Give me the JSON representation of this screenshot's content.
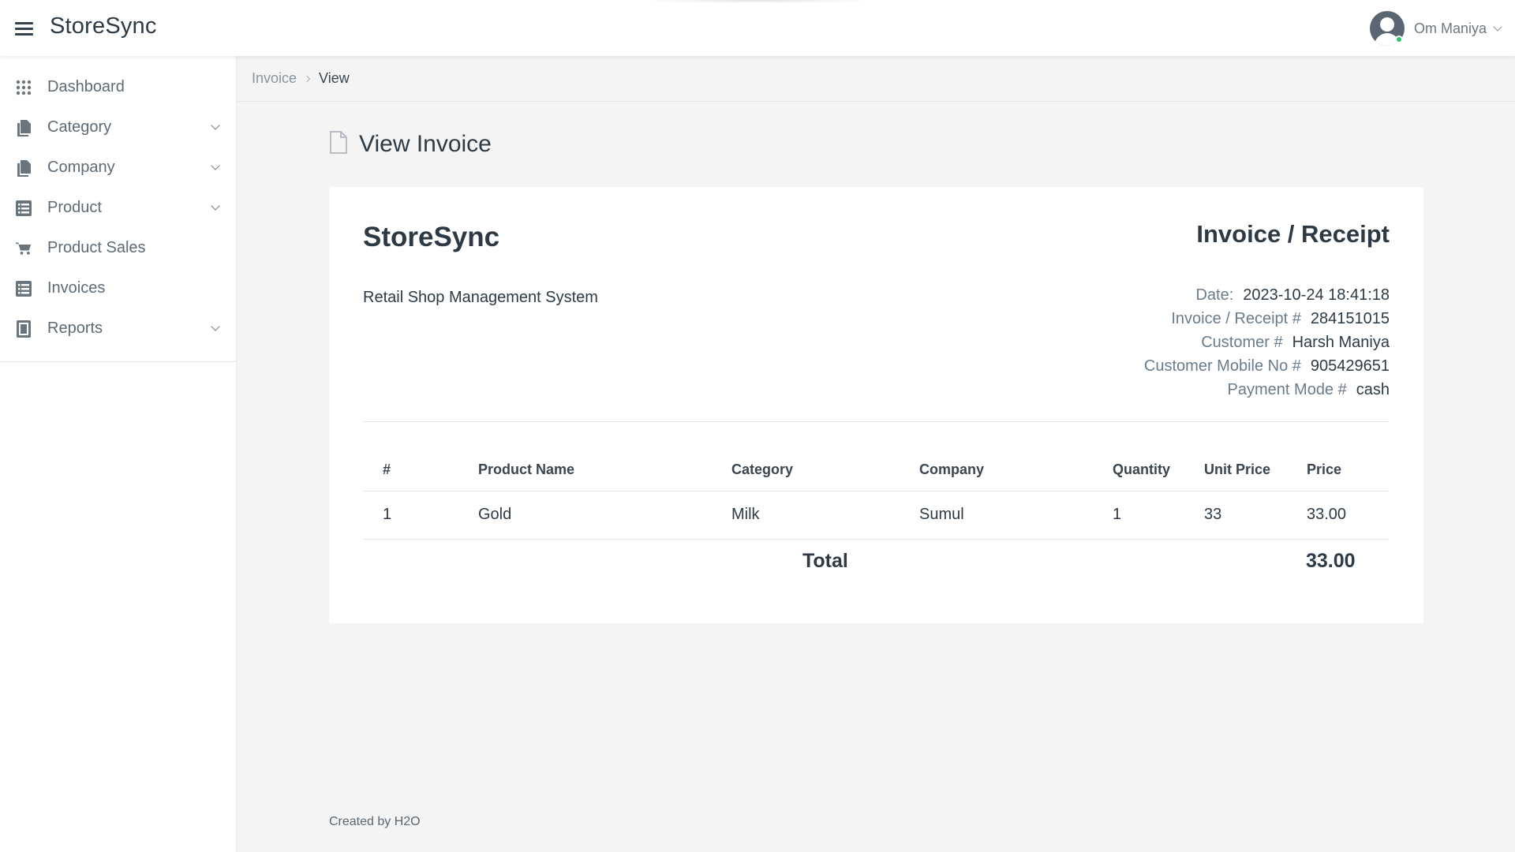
{
  "app": {
    "brand": "StoreSync"
  },
  "header": {
    "user_name": "Om Maniya"
  },
  "sidebar": {
    "items": [
      {
        "label": "Dashboard",
        "icon": "grid-icon",
        "has_children": false
      },
      {
        "label": "Category",
        "icon": "documents-icon",
        "has_children": true
      },
      {
        "label": "Company",
        "icon": "documents-icon",
        "has_children": true
      },
      {
        "label": "Product",
        "icon": "list-icon",
        "has_children": true
      },
      {
        "label": "Product Sales",
        "icon": "cart-icon",
        "has_children": false
      },
      {
        "label": "Invoices",
        "icon": "list-icon",
        "has_children": false
      },
      {
        "label": "Reports",
        "icon": "calculator-icon",
        "has_children": true
      }
    ]
  },
  "breadcrumb": {
    "parent": "Invoice",
    "current": "View"
  },
  "page": {
    "title": "View Invoice",
    "title_icon": "file-icon"
  },
  "invoice": {
    "brand": "StoreSync",
    "subtitle": "Retail Shop Management System",
    "heading": "Invoice / Receipt",
    "meta": [
      {
        "label": "Date:",
        "value": "2023-10-24 18:41:18"
      },
      {
        "label": "Invoice / Receipt #",
        "value": "284151015"
      },
      {
        "label": "Customer #",
        "value": "Harsh Maniya"
      },
      {
        "label": "Customer Mobile No #",
        "value": "905429651"
      },
      {
        "label": "Payment Mode #",
        "value": "cash"
      }
    ],
    "columns": [
      "#",
      "Product Name",
      "Category",
      "Company",
      "Quantity",
      "Unit Price",
      "Price"
    ],
    "rows": [
      [
        "1",
        "Gold",
        "Milk",
        "Sumul",
        "1",
        "33",
        "33.00"
      ]
    ],
    "total_label": "Total",
    "total_value": "33.00"
  },
  "footer": {
    "prefix": "Created by ",
    "author": "H2O"
  },
  "colors": {
    "text_dark": "#2d3a45",
    "muted": "#6a7c8c",
    "online": "#28c76f",
    "background": "#f4f4f4"
  }
}
